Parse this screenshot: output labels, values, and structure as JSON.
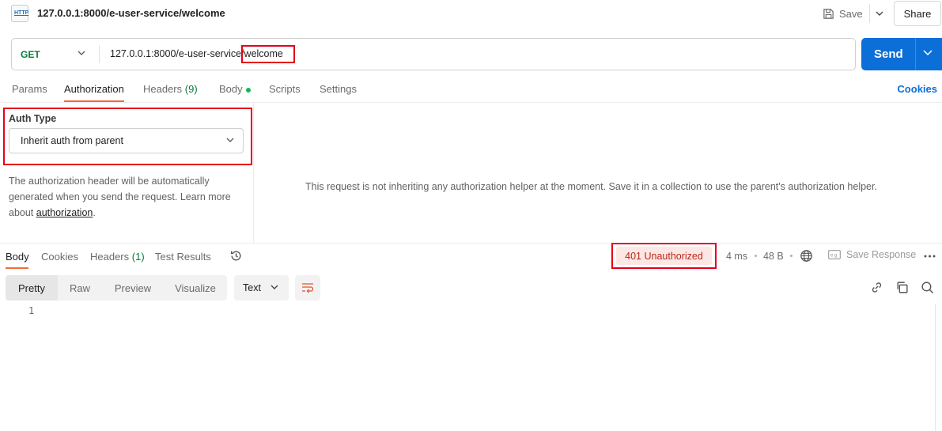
{
  "window": {
    "title": "127.0.0.1:8000/e-user-service/welcome",
    "file_icon": "http-file-icon",
    "file_icon_text": "HTTP",
    "save_label": "Save",
    "share_label": "Share"
  },
  "request": {
    "method": "GET",
    "url_prefix": "127.0.0.1:8000/e-user-service/",
    "url_highlight": "welcome",
    "send_label": "Send"
  },
  "request_tabs": {
    "params": "Params",
    "authorization": "Authorization",
    "headers": "Headers",
    "headers_count": "(9)",
    "body": "Body",
    "scripts": "Scripts",
    "settings": "Settings",
    "cookies": "Cookies"
  },
  "auth": {
    "type_label": "Auth Type",
    "selected": "Inherit auth from parent",
    "desc_part1": "The authorization header will be automatically generated when you send the request. Learn more about ",
    "desc_link": "authorization",
    "desc_end": ".",
    "message": "This request is not inheriting any authorization helper at the moment. Save it in a collection to use the parent's authorization helper."
  },
  "response_tabs": {
    "body": "Body",
    "cookies": "Cookies",
    "headers": "Headers",
    "headers_count": "(1)",
    "test_results": "Test Results"
  },
  "response": {
    "status": "401 Unauthorized",
    "time": "4 ms",
    "size": "48 B",
    "save_response": "Save Response"
  },
  "view": {
    "pretty": "Pretty",
    "raw": "Raw",
    "preview": "Preview",
    "visualize": "Visualize",
    "format": "Text"
  },
  "editor": {
    "line_number": "1"
  },
  "colors": {
    "send": "#0c6fd8",
    "method": "#0a7a3c",
    "status_text": "#b8261b",
    "status_bg": "#fde7e4",
    "tab_underline": "#f26b3a",
    "highlight": "#e6001a"
  }
}
